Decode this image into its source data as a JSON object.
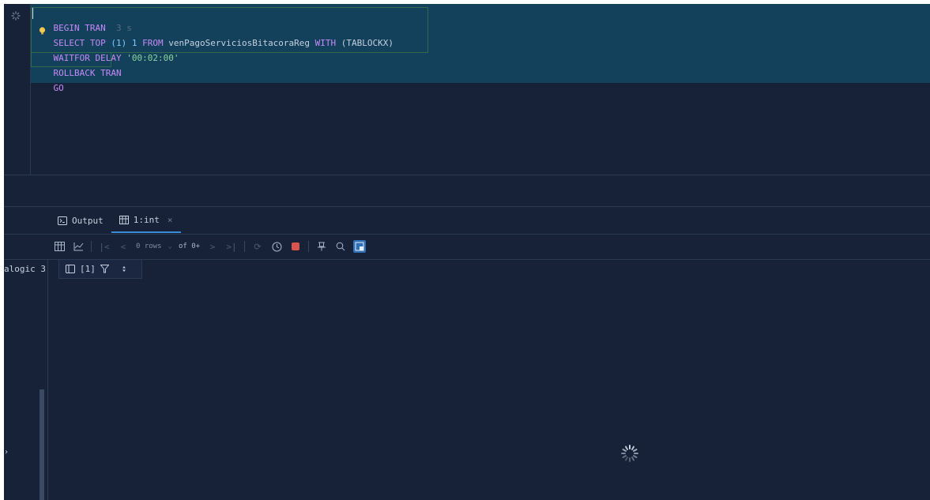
{
  "editor": {
    "line1_kw": "BEGIN TRAN",
    "line1_hint": "3 s",
    "line2_select": "SELECT TOP",
    "line2_paren": "(1)",
    "line2_one": "1",
    "line2_from": "FROM",
    "line2_table": "venPagoServiciosBitacoraReg",
    "line2_with": "WITH",
    "line2_hint": "(TABLOCKX)",
    "line3_kw": "WAITFOR DELAY",
    "line3_str": "'00:02:00'",
    "line4_kw": "ROLLBACK TRAN",
    "line5_kw": "GO"
  },
  "panel": {
    "tabs": [
      {
        "label": "Output",
        "icon": "terminal-icon"
      },
      {
        "label": "1:int",
        "icon": "table-icon",
        "close": "×"
      }
    ],
    "toolbar": {
      "rows_label": "0 rows",
      "of_label": "of 0+"
    },
    "left_label": "alogic 3",
    "grid_header": {
      "label": "[1]"
    },
    "left_arrow": "›"
  },
  "colors": {
    "background": "#172238",
    "selection": "#13405a",
    "keyword": "#c58af9",
    "string": "#8bd49c",
    "accent": "#3b8bd6"
  }
}
